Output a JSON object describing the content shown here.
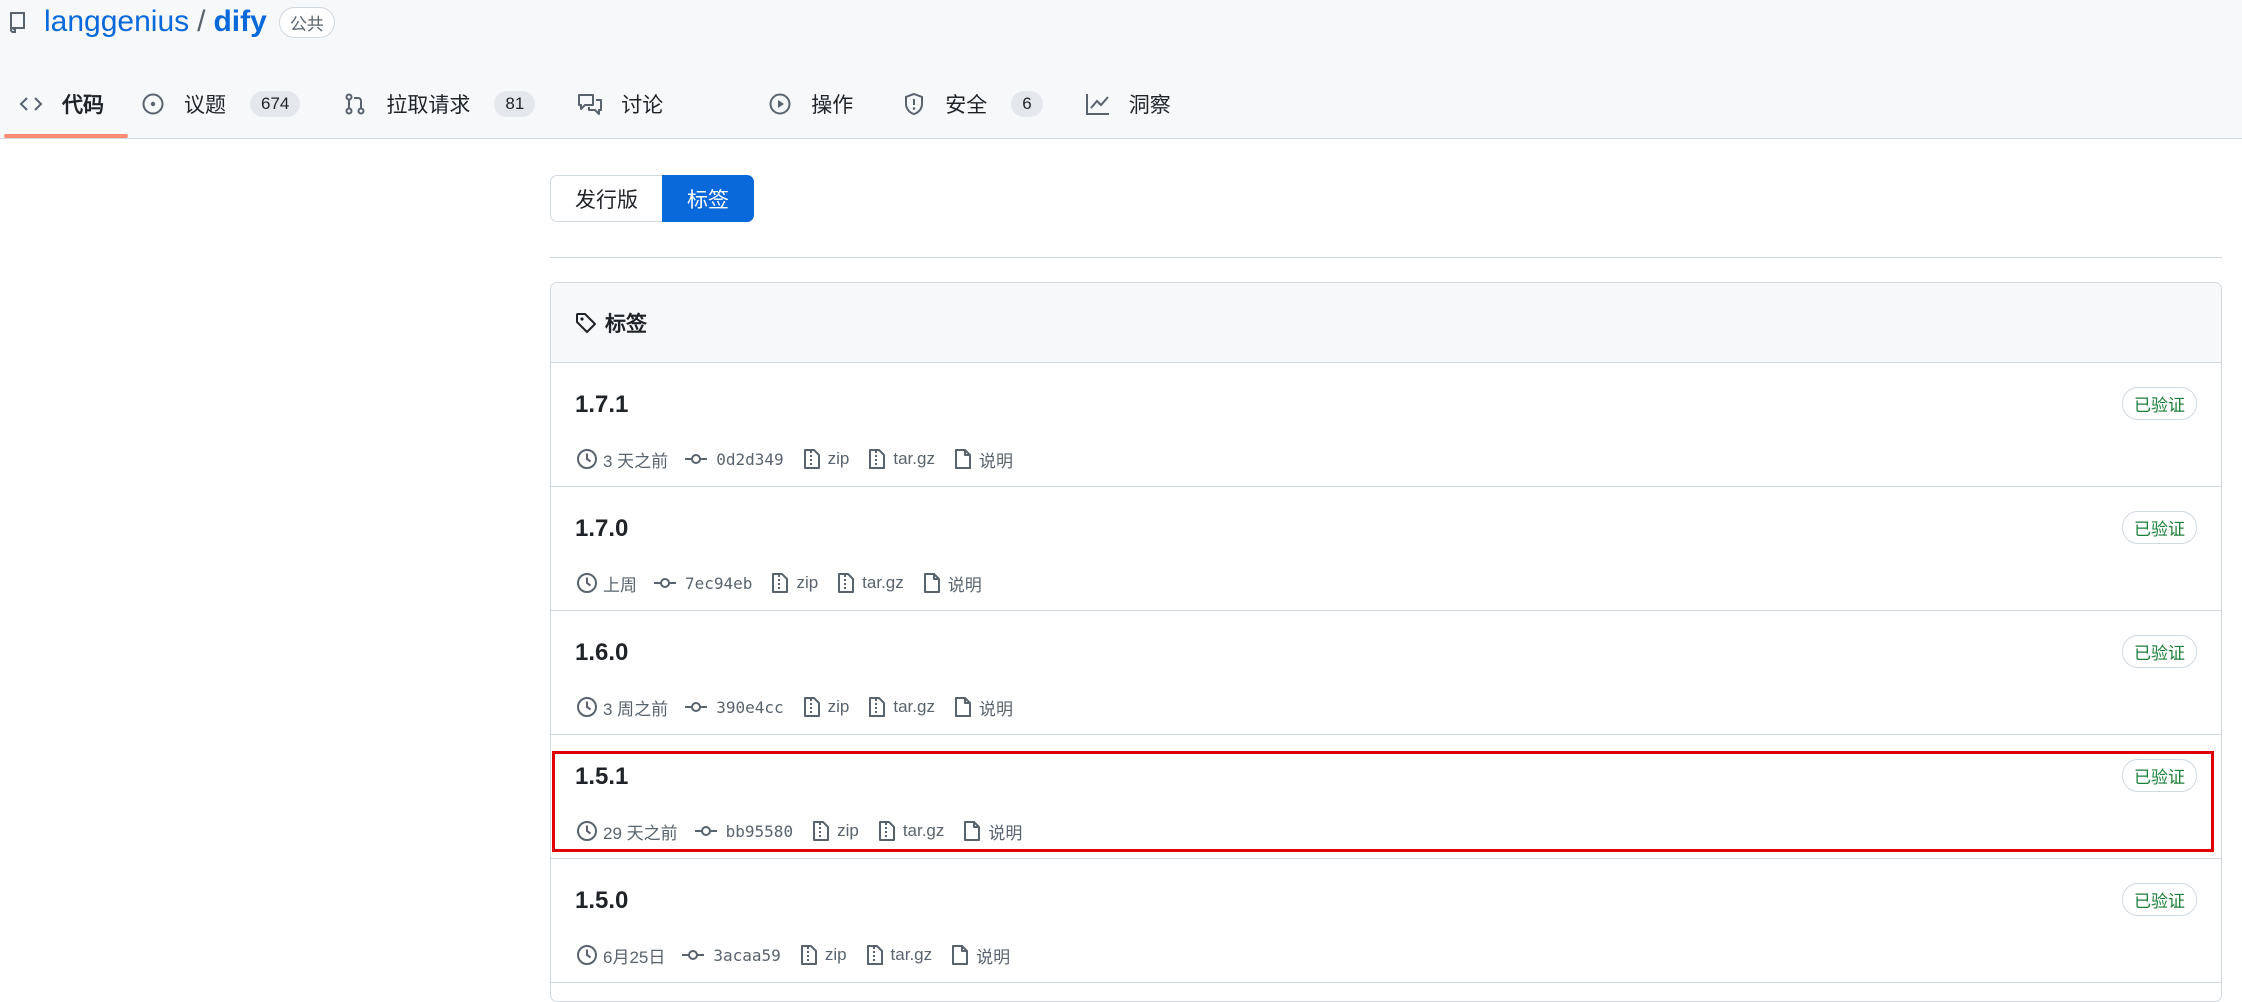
{
  "repo": {
    "owner": "langgenius",
    "separator": "/",
    "name": "dify",
    "visibility": "公共"
  },
  "nav": {
    "tabs": [
      {
        "label": "代码",
        "icon": "code-icon",
        "count": null,
        "active": true
      },
      {
        "label": "议题",
        "icon": "issue-icon",
        "count": "674"
      },
      {
        "label": "拉取请求",
        "icon": "pull-request-icon",
        "count": "81"
      },
      {
        "label": "讨论",
        "icon": "discussion-icon",
        "count": null
      },
      {
        "label": "操作",
        "icon": "play-icon",
        "count": null
      },
      {
        "label": "安全",
        "icon": "shield-icon",
        "count": "6"
      },
      {
        "label": "洞察",
        "icon": "graph-icon",
        "count": null
      }
    ]
  },
  "segment": {
    "releases": "发行版",
    "tags": "标签"
  },
  "tags_box": {
    "heading": "标签",
    "rows": [
      {
        "version": "1.7.1",
        "time": "3 天之前",
        "sha": "0d2d349",
        "zip": "zip",
        "targz": "tar.gz",
        "notes": "说明",
        "badge": "已验证"
      },
      {
        "version": "1.7.0",
        "time": "上周",
        "sha": "7ec94eb",
        "zip": "zip",
        "targz": "tar.gz",
        "notes": "说明",
        "badge": "已验证"
      },
      {
        "version": "1.6.0",
        "time": "3 周之前",
        "sha": "390e4cc",
        "zip": "zip",
        "targz": "tar.gz",
        "notes": "说明",
        "badge": "已验证"
      },
      {
        "version": "1.5.1",
        "time": "29 天之前",
        "sha": "bb95580",
        "zip": "zip",
        "targz": "tar.gz",
        "notes": "说明",
        "badge": "已验证"
      },
      {
        "version": "1.5.0",
        "time": "6月25日",
        "sha": "3acaa59",
        "zip": "zip",
        "targz": "tar.gz",
        "notes": "说明",
        "badge": "已验证"
      }
    ]
  },
  "colors": {
    "link": "#0969da",
    "accent_underline": "#fd8c73",
    "verified": "#1a7f37",
    "highlight": "#e00000"
  }
}
